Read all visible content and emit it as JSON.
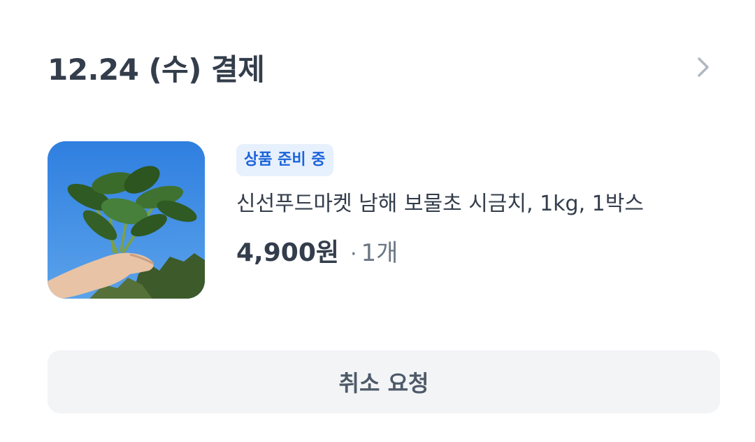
{
  "order": {
    "title": "12.24 (수) 결제",
    "detail_icon": "chevron-right-icon"
  },
  "product": {
    "image_icon": "spinach-photo",
    "status_badge": "상품 준비 중",
    "name": "신선푸드마켓 남해 보물초 시금치, 1kg, 1박스",
    "price": "4,900원",
    "separator": "·",
    "quantity": "1개"
  },
  "actions": {
    "cancel_label": "취소 요청"
  },
  "colors": {
    "title": "#333d4b",
    "badge_bg": "#e7f0fd",
    "badge_text": "#1b64da",
    "button_bg": "#f2f4f6",
    "button_text": "#4e5968",
    "muted": "#6b7684",
    "chevron": "#b0b8c1"
  }
}
